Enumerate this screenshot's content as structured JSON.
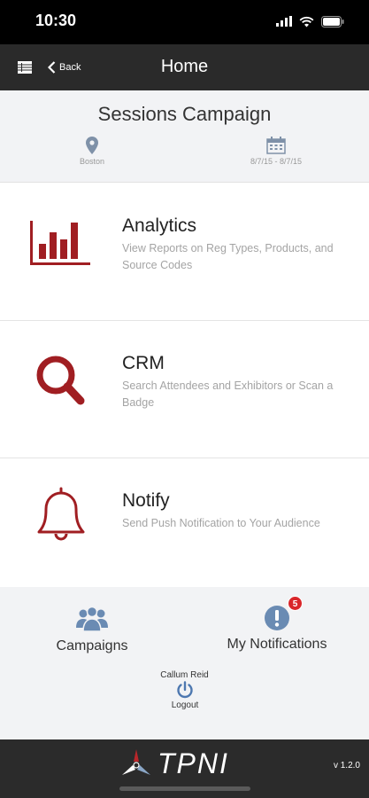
{
  "status_bar": {
    "time": "10:30"
  },
  "nav": {
    "back_label": "Back",
    "title": "Home"
  },
  "campaign": {
    "title": "Sessions Campaign",
    "location": "Boston",
    "dates": "8/7/15 - 8/7/15"
  },
  "menu": [
    {
      "title": "Analytics",
      "description": "View Reports on Reg Types, Products, and Source Codes",
      "icon": "bar-chart-icon"
    },
    {
      "title": "CRM",
      "description": "Search Attendees and Exhibitors or Scan a Badge",
      "icon": "magnifier-icon"
    },
    {
      "title": "Notify",
      "description": "Send Push Notification to Your Audience",
      "icon": "bell-icon"
    }
  ],
  "footer": {
    "campaigns_label": "Campaigns",
    "notifications_label": "My Notifications",
    "notification_count": "5",
    "user_name": "Callum Reid",
    "logout_label": "Logout"
  },
  "brand": {
    "logo_text": "TPNI",
    "version": "v 1.2.0"
  },
  "colors": {
    "accent": "#a01e22",
    "icon_blue": "#6a8bb3",
    "dark_bar": "#2a2a2a",
    "badge": "#d9262a"
  }
}
